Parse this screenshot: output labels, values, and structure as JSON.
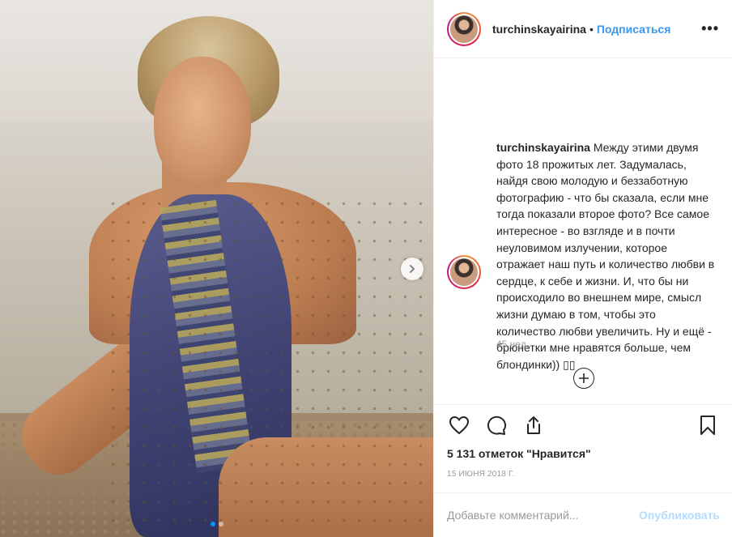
{
  "post": {
    "username": "turchinskayairina",
    "follow_label": "Подписаться",
    "separator": "•",
    "more_label": "•••"
  },
  "caption": {
    "username": "turchinskayairina",
    "text": "Между этими двумя фото 18 прожитых лет. Задумалась, найдя свою молодую и беззаботную фотографию - что бы сказала, если мне тогда показали второе фото? Все самое интересное - во взгляде и в почти неуловимом излучении, которое отражает наш путь и количество любви в сердце, к себе и жизни. И, что бы ни происходило во внешнем мире, смысл жизни думаю в том, чтобы это количество любви увеличить. Ну и ещё - брюнетки мне нравятся больше, чем блондинки)) ▯▯",
    "time_ago": "45 нед."
  },
  "stats": {
    "likes": "5 131 отметок \"Нравится\"",
    "date": "15 ИЮНЯ 2018 Г."
  },
  "comment": {
    "placeholder": "Добавьте комментарий...",
    "publish_label": "Опубликовать"
  },
  "carousel": {
    "current_index": 1,
    "total": 2
  },
  "colors": {
    "link_blue": "#3897f0",
    "publish_disabled": "#b3dbff",
    "active_dot": "#0095f6"
  },
  "icons": [
    "chevron-right-icon",
    "heart-icon",
    "comment-icon",
    "share-icon",
    "bookmark-icon",
    "plus-circle-icon",
    "more-icon"
  ]
}
